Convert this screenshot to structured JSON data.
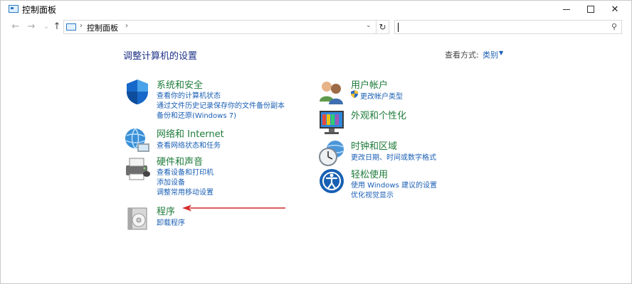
{
  "window": {
    "title": "控制面板"
  },
  "address": {
    "crumbs": [
      "控制面板"
    ],
    "search_placeholder": ""
  },
  "main": {
    "heading": "调整计算机的设置",
    "view_by_label": "查看方式:",
    "view_by_value": "类别"
  },
  "categories": {
    "security": {
      "title": "系统和安全",
      "links": [
        "查看你的计算机状态",
        "通过文件历史记录保存你的文件备份副本",
        "备份和还原(Windows 7)"
      ]
    },
    "network": {
      "title": "网络和 Internet",
      "links": [
        "查看网络状态和任务"
      ]
    },
    "hardware": {
      "title": "硬件和声音",
      "links": [
        "查看设备和打印机",
        "添加设备",
        "调整常用移动设置"
      ]
    },
    "programs": {
      "title": "程序",
      "links": [
        "卸载程序"
      ]
    },
    "users": {
      "title": "用户帐户",
      "links": [
        "更改帐户类型"
      ]
    },
    "appearance": {
      "title": "外观和个性化",
      "links": []
    },
    "clock": {
      "title": "时钟和区域",
      "links": [
        "更改日期、时间或数字格式"
      ]
    },
    "ease": {
      "title": "轻松使用",
      "links": [
        "使用 Windows 建议的设置",
        "优化视觉显示"
      ]
    }
  },
  "colors": {
    "link": "#1a5fb4",
    "category_title": "#1e7b3a",
    "heading": "#1e3287",
    "annotation_arrow": "#d42a2a"
  }
}
